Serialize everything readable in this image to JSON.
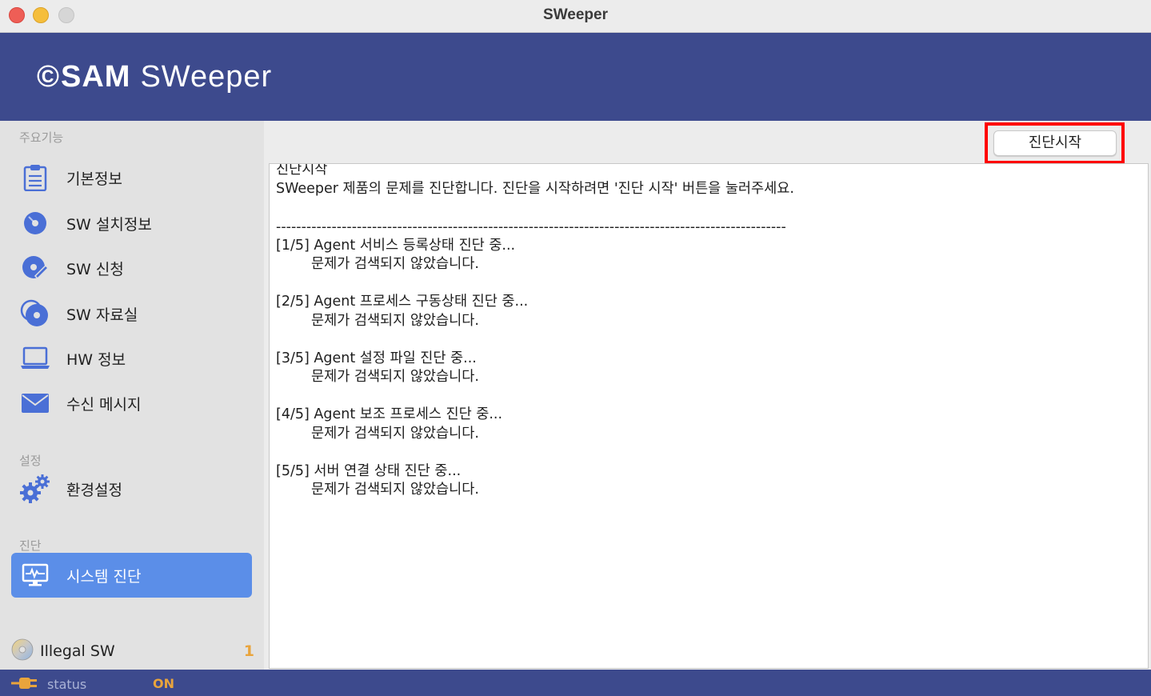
{
  "window": {
    "title": "SWeeper"
  },
  "header": {
    "logo_symbol": "©",
    "logo_brand": "SAM",
    "logo_product": "SWeeper"
  },
  "sidebar": {
    "section_main": "주요기능",
    "items": [
      {
        "label": "기본정보",
        "icon": "clipboard-icon"
      },
      {
        "label": "SW 설치정보",
        "icon": "disc-icon"
      },
      {
        "label": "SW 신청",
        "icon": "disc-pen-icon"
      },
      {
        "label": "SW 자료실",
        "icon": "disc-stack-icon"
      },
      {
        "label": "HW 정보",
        "icon": "laptop-icon"
      },
      {
        "label": "수신 메시지",
        "icon": "envelope-icon"
      }
    ],
    "section_settings": "설정",
    "settings_item": {
      "label": "환경설정",
      "icon": "gears-icon"
    },
    "section_diag": "진단",
    "diag_item": {
      "label": "시스템 진단",
      "icon": "monitor-pulse-icon"
    },
    "illegal": {
      "label": "Illegal SW",
      "count": "1"
    }
  },
  "main": {
    "start_button": "진단시작",
    "log": {
      "title": "진단시작",
      "intro": "SWeeper 제품의 문제를 진단합니다. 진단을 시작하려면 '진단 시작' 버튼을 눌러주세요.",
      "separator": "-----------------------------------------------------------------------------------------------------",
      "steps": [
        {
          "head": "[1/5] Agent 서비스 등록상태 진단 중...",
          "result": "문제가 검색되지 않았습니다."
        },
        {
          "head": "[2/5] Agent 프로세스 구동상태 진단 중...",
          "result": "문제가 검색되지 않았습니다."
        },
        {
          "head": "[3/5] Agent 설정 파일 진단 중...",
          "result": "문제가 검색되지 않았습니다."
        },
        {
          "head": "[4/5] Agent 보조 프로세스 진단 중...",
          "result": "문제가 검색되지 않았습니다."
        },
        {
          "head": "[5/5] 서버 연결 상태 진단 중...",
          "result": "문제가 검색되지 않았습니다."
        }
      ]
    }
  },
  "statusbar": {
    "label": "status",
    "value": "ON"
  },
  "colors": {
    "header": "#3d4a8d",
    "active": "#5b8ee8",
    "accent": "#e9a43c",
    "icon": "#4a6fd6"
  }
}
